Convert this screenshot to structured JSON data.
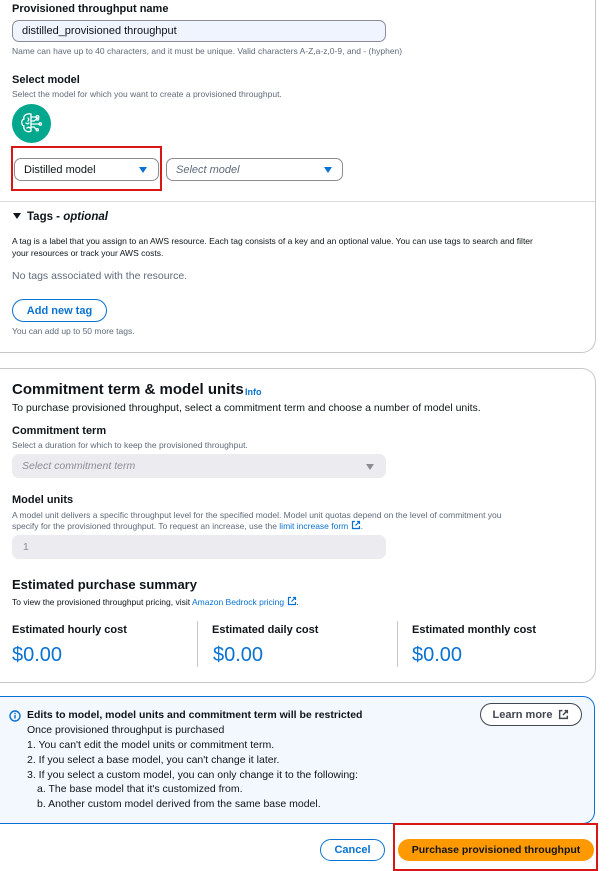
{
  "name_section": {
    "label": "Provisioned throughput name",
    "value": "distilled_provisioned throughput",
    "help": "Name can have up to 40 characters, and it must be unique. Valid characters A-Z,a-z,0-9, and - (hyphen)"
  },
  "model_section": {
    "label": "Select model",
    "desc": "Select the model for which you want to create a provisioned throughput.",
    "model_type": "Distilled model",
    "model_placeholder": "Select model"
  },
  "tags": {
    "title": "Tags - ",
    "optional": "optional",
    "desc1": "A tag is a label that you assign to an AWS resource. Each tag consists of a key and an optional value. You can use tags to search and filter",
    "desc2": "your resources or track your AWS costs.",
    "empty": "No tags associated with the resource.",
    "add_button": "Add new tag",
    "limit": "You can add up to 50 more tags."
  },
  "commitment": {
    "title": "Commitment term & model units",
    "info": "Info",
    "desc": "To purchase provisioned throughput, select a commitment term and choose a number of model units.",
    "term_label": "Commitment term",
    "term_desc": "Select a duration for which to keep the provisioned throughput.",
    "term_placeholder": "Select commitment term",
    "units_label": "Model units",
    "units_desc1": "A model unit delivers a specific throughput level for the specified model. Model unit quotas depend on the level of commitment you",
    "units_desc2": "specify for the provisioned throughput. To request an increase, use the ",
    "units_link": "limit increase form",
    "units_value": "1"
  },
  "summary": {
    "title": "Estimated purchase summary",
    "desc": "To view the provisioned throughput pricing, visit ",
    "link": "Amazon Bedrock pricing",
    "costs": [
      {
        "label": "Estimated hourly cost",
        "value": "$0.00"
      },
      {
        "label": "Estimated daily cost",
        "value": "$0.00"
      },
      {
        "label": "Estimated monthly cost",
        "value": "$0.00"
      }
    ]
  },
  "alert": {
    "title": "Edits to model, model units and commitment term will be restricted",
    "learn_more": "Learn more",
    "lines": [
      "Once provisioned throughput is purchased",
      "1. You can't edit the model units or commitment term.",
      "2. If you select a base model, you can't change it later.",
      "3. If you select a custom model, you can only change it to the following:",
      "a. The base model that it's customized from.",
      "b. Another custom model derived from the same base model."
    ]
  },
  "footer": {
    "cancel": "Cancel",
    "purchase": "Purchase provisioned throughput"
  },
  "colors": {
    "accent": "#0972d3",
    "primary_button": "#ff9900",
    "highlight": "#d91515",
    "model_icon": "#01a88d"
  },
  "icons": [
    "brain-circuit-icon",
    "chevron-down-icon",
    "triangle-expand-icon",
    "external-link-icon",
    "info-circle-icon"
  ]
}
